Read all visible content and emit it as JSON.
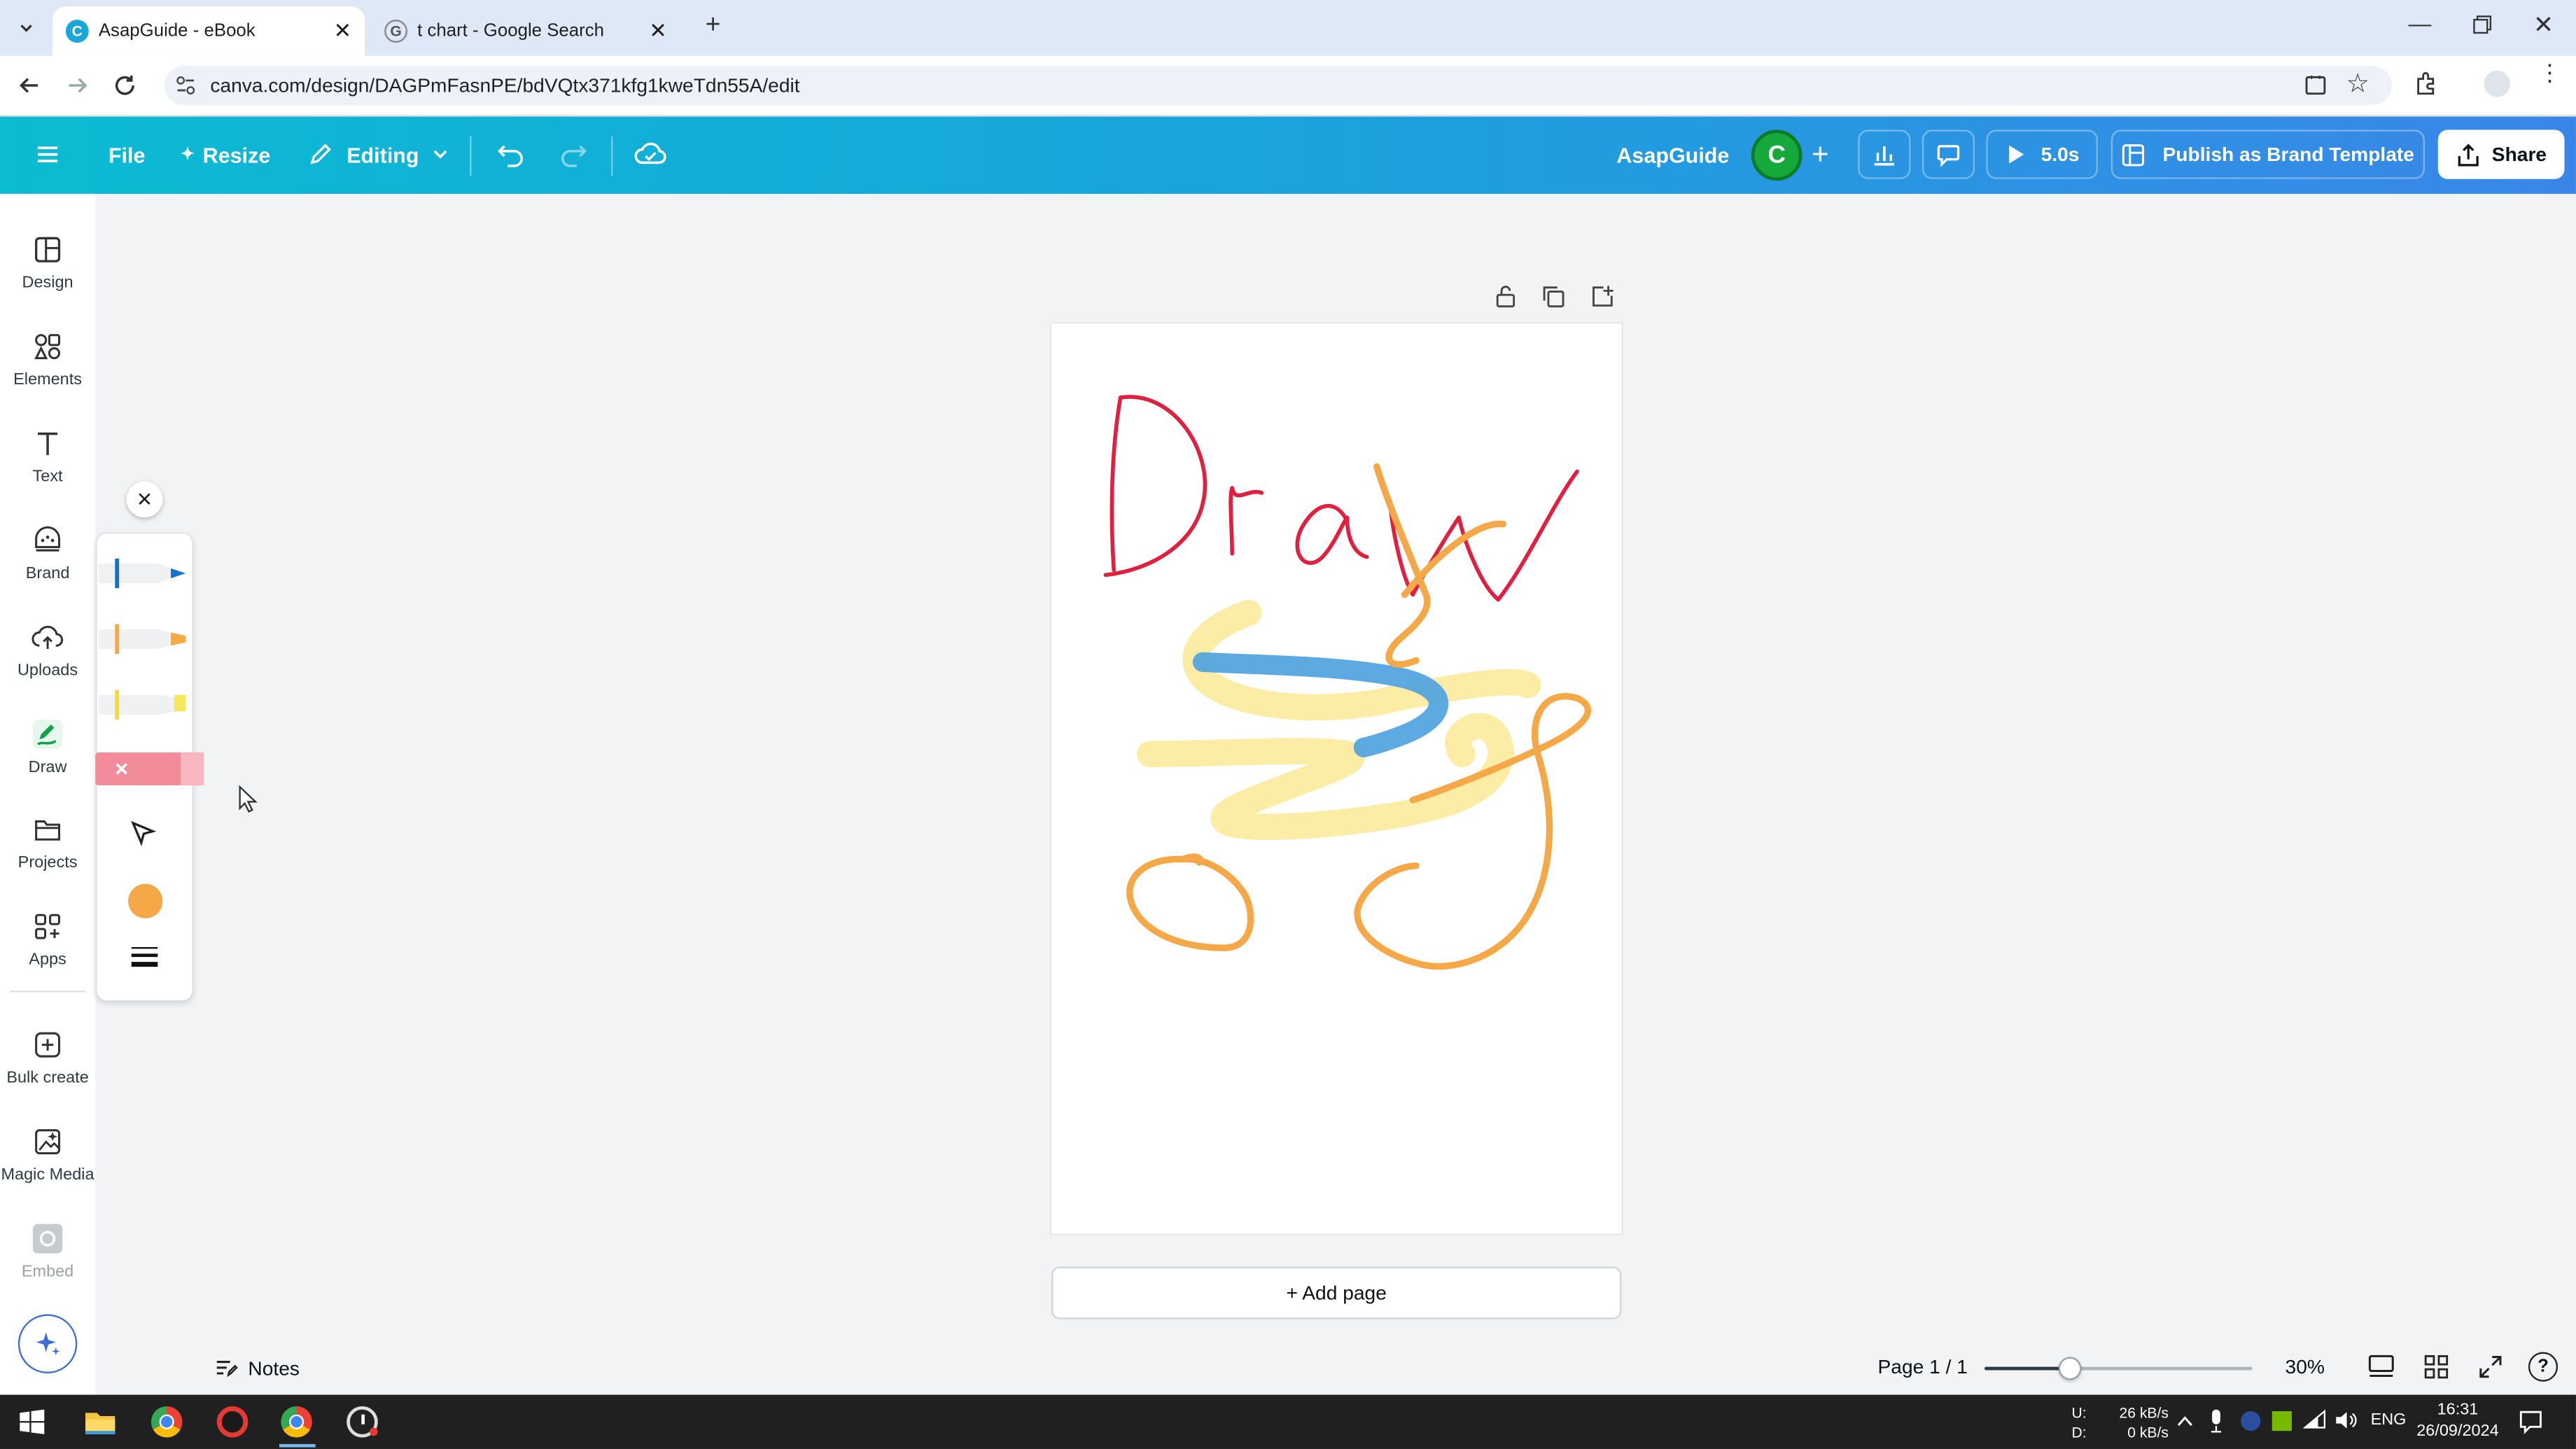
{
  "browser": {
    "tabs": [
      {
        "title": "AsapGuide - eBook",
        "active": true
      },
      {
        "title": "t chart - Google Search",
        "active": false
      }
    ],
    "url": "canva.com/design/DAGPmFasnPE/bdVQtx371kfg1kweTdn55A/edit"
  },
  "header": {
    "file_label": "File",
    "resize_label": "Resize",
    "editing_label": "Editing",
    "brand_name": "AsapGuide",
    "avatar_initial": "C",
    "timer_label": "5.0s",
    "publish_label": "Publish as Brand Template",
    "share_label": "Share",
    "accent": "#13a9d6"
  },
  "sidebar": {
    "items": [
      {
        "label": "Design",
        "icon": "layout-icon"
      },
      {
        "label": "Elements",
        "icon": "shapes-icon"
      },
      {
        "label": "Text",
        "icon": "text-icon"
      },
      {
        "label": "Brand",
        "icon": "brand-icon"
      },
      {
        "label": "Uploads",
        "icon": "cloud-upload-icon"
      },
      {
        "label": "Draw",
        "icon": "draw-icon"
      },
      {
        "label": "Projects",
        "icon": "folder-icon"
      },
      {
        "label": "Apps",
        "icon": "apps-icon"
      },
      {
        "label": "Bulk create",
        "icon": "bulk-create-icon"
      },
      {
        "label": "Magic Media",
        "icon": "magic-media-icon"
      },
      {
        "label": "Embed",
        "icon": "embed-icon"
      }
    ]
  },
  "draw_panel": {
    "tools": [
      "pen",
      "marker",
      "highlighter",
      "eraser",
      "select"
    ],
    "selected_color": "#f5a847"
  },
  "canvas": {
    "add_page_label": "+ Add page",
    "stroke_colors": {
      "red": "#e0203f",
      "orange": "#f5a847",
      "yellow": "#fbeb9c",
      "blue": "#4fa3e0"
    }
  },
  "bottom": {
    "notes_label": "Notes",
    "page_label": "Page 1 / 1",
    "zoom_label": "30%",
    "zoom_fraction": 0.3
  },
  "taskbar": {
    "net_up_label": "U:",
    "net_down_label": "D:",
    "net_up": "26 kB/s",
    "net_down": "0 kB/s",
    "lang": "ENG",
    "time": "16:31",
    "date": "26/09/2024"
  }
}
